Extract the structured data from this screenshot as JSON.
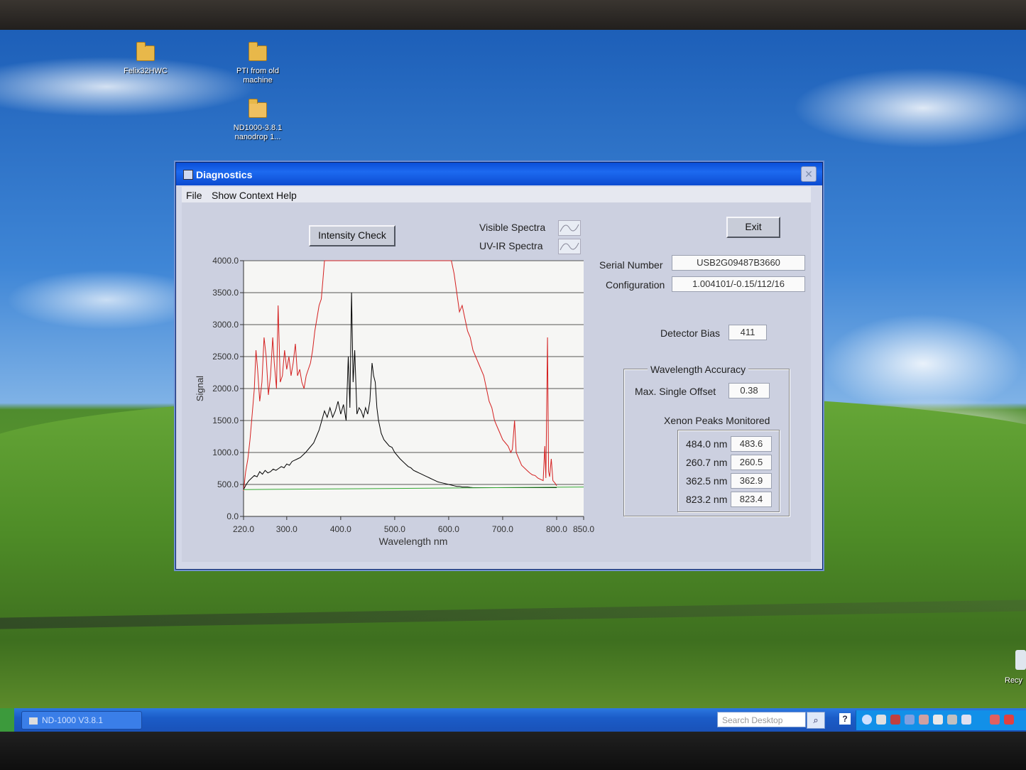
{
  "desktop": {
    "icons": [
      {
        "label": "Felix32HWC"
      },
      {
        "label": "PTI from old machine"
      },
      {
        "label": "ND1000-3.8.1 nanodrop 1..."
      }
    ],
    "recycle_label": "Recy"
  },
  "window": {
    "title": "Diagnostics",
    "menu": [
      "File",
      "Show Context Help"
    ],
    "intensity_button": "Intensity Check",
    "exit_button": "Exit",
    "legend": [
      {
        "label": "Visible Spectra",
        "color": "#d42020"
      },
      {
        "label": "UV-IR Spectra",
        "color": "#000000"
      }
    ],
    "serial_label": "Serial Number",
    "serial_value": "USB2G09487B3660",
    "config_label": "Configuration",
    "config_value": "1.004101/-0.15/112/16",
    "bias_label": "Detector Bias",
    "bias_value": "411",
    "accuracy": {
      "title": "Wavelength Accuracy",
      "offset_label": "Max. Single Offset",
      "offset_value": "0.38",
      "peaks_title": "Xenon Peaks Monitored",
      "peaks": [
        {
          "label": "484.0 nm",
          "value": "483.6"
        },
        {
          "label": "260.7 nm",
          "value": "260.5"
        },
        {
          "label": "362.5 nm",
          "value": "362.9"
        },
        {
          "label": "823.2 nm",
          "value": "823.4"
        }
      ]
    }
  },
  "chart_data": {
    "type": "line",
    "xlabel": "Wavelength nm",
    "ylabel": "Signal",
    "xlim": [
      220,
      850
    ],
    "ylim": [
      0,
      4000
    ],
    "x_ticks": [
      "220.0",
      "300.0",
      "400.0",
      "500.0",
      "600.0",
      "700.0",
      "800.0",
      "850.0"
    ],
    "x_tick_values": [
      220,
      300,
      400,
      500,
      600,
      700,
      800,
      850
    ],
    "y_ticks": [
      "0.0",
      "500.0",
      "1000.0",
      "1500.0",
      "2000.0",
      "2500.0",
      "3000.0",
      "3500.0",
      "4000.0"
    ],
    "y_tick_values": [
      0,
      500,
      1000,
      1500,
      2000,
      2500,
      3000,
      3500,
      4000
    ],
    "grid": true,
    "series": [
      {
        "name": "Visible Spectra",
        "color": "#d42020",
        "points": [
          [
            220,
            400
          ],
          [
            224,
            700
          ],
          [
            228,
            900
          ],
          [
            232,
            1200
          ],
          [
            236,
            1600
          ],
          [
            240,
            2000
          ],
          [
            243,
            2600
          ],
          [
            246,
            2300
          ],
          [
            250,
            1800
          ],
          [
            254,
            2100
          ],
          [
            258,
            2800
          ],
          [
            262,
            2500
          ],
          [
            266,
            1900
          ],
          [
            270,
            2200
          ],
          [
            274,
            2800
          ],
          [
            277,
            2400
          ],
          [
            281,
            2000
          ],
          [
            284,
            3300
          ],
          [
            288,
            2100
          ],
          [
            292,
            2200
          ],
          [
            296,
            2600
          ],
          [
            300,
            2300
          ],
          [
            304,
            2500
          ],
          [
            308,
            2200
          ],
          [
            312,
            2400
          ],
          [
            316,
            2700
          ],
          [
            320,
            2200
          ],
          [
            324,
            2300
          ],
          [
            328,
            2100
          ],
          [
            332,
            2000
          ],
          [
            336,
            2200
          ],
          [
            340,
            2300
          ],
          [
            344,
            2400
          ],
          [
            348,
            2600
          ],
          [
            352,
            2900
          ],
          [
            356,
            3100
          ],
          [
            360,
            3300
          ],
          [
            364,
            3400
          ],
          [
            367,
            3700
          ],
          [
            370,
            4000
          ],
          [
            374,
            4000
          ],
          [
            380,
            4000
          ],
          [
            390,
            4000
          ],
          [
            600,
            4000
          ],
          [
            605,
            4000
          ],
          [
            610,
            3800
          ],
          [
            615,
            3500
          ],
          [
            620,
            3200
          ],
          [
            625,
            3300
          ],
          [
            630,
            3100
          ],
          [
            635,
            2900
          ],
          [
            640,
            2800
          ],
          [
            645,
            2600
          ],
          [
            650,
            2500
          ],
          [
            655,
            2400
          ],
          [
            660,
            2300
          ],
          [
            665,
            2200
          ],
          [
            670,
            2000
          ],
          [
            675,
            1800
          ],
          [
            680,
            1700
          ],
          [
            685,
            1500
          ],
          [
            690,
            1400
          ],
          [
            695,
            1300
          ],
          [
            700,
            1200
          ],
          [
            705,
            1150
          ],
          [
            710,
            1100
          ],
          [
            715,
            1000
          ],
          [
            718,
            1050
          ],
          [
            722,
            1500
          ],
          [
            725,
            1000
          ],
          [
            730,
            900
          ],
          [
            735,
            800
          ],
          [
            740,
            760
          ],
          [
            745,
            720
          ],
          [
            750,
            680
          ],
          [
            755,
            650
          ],
          [
            760,
            640
          ],
          [
            765,
            600
          ],
          [
            770,
            580
          ],
          [
            775,
            560
          ],
          [
            778,
            1100
          ],
          [
            780,
            600
          ],
          [
            783,
            2800
          ],
          [
            785,
            700
          ],
          [
            787,
            620
          ],
          [
            790,
            900
          ],
          [
            793,
            560
          ],
          [
            797,
            520
          ],
          [
            800,
            480
          ]
        ]
      },
      {
        "name": "UV-IR Spectra",
        "color": "#000000",
        "points": [
          [
            220,
            420
          ],
          [
            225,
            500
          ],
          [
            230,
            560
          ],
          [
            235,
            600
          ],
          [
            240,
            640
          ],
          [
            245,
            620
          ],
          [
            250,
            700
          ],
          [
            255,
            660
          ],
          [
            260,
            720
          ],
          [
            265,
            680
          ],
          [
            270,
            700
          ],
          [
            275,
            740
          ],
          [
            280,
            720
          ],
          [
            285,
            750
          ],
          [
            290,
            780
          ],
          [
            295,
            760
          ],
          [
            300,
            820
          ],
          [
            305,
            800
          ],
          [
            310,
            860
          ],
          [
            315,
            880
          ],
          [
            320,
            900
          ],
          [
            325,
            920
          ],
          [
            330,
            960
          ],
          [
            335,
            1000
          ],
          [
            340,
            1050
          ],
          [
            345,
            1100
          ],
          [
            350,
            1150
          ],
          [
            355,
            1250
          ],
          [
            360,
            1350
          ],
          [
            365,
            1500
          ],
          [
            370,
            1650
          ],
          [
            375,
            1550
          ],
          [
            380,
            1700
          ],
          [
            385,
            1550
          ],
          [
            390,
            1650
          ],
          [
            395,
            1800
          ],
          [
            400,
            1600
          ],
          [
            405,
            1750
          ],
          [
            410,
            1500
          ],
          [
            414,
            2500
          ],
          [
            417,
            1700
          ],
          [
            420,
            3500
          ],
          [
            423,
            2100
          ],
          [
            426,
            2600
          ],
          [
            430,
            1600
          ],
          [
            434,
            1700
          ],
          [
            438,
            1650
          ],
          [
            442,
            1550
          ],
          [
            446,
            1700
          ],
          [
            450,
            1600
          ],
          [
            454,
            1800
          ],
          [
            458,
            2400
          ],
          [
            461,
            2200
          ],
          [
            464,
            2100
          ],
          [
            467,
            1700
          ],
          [
            470,
            1500
          ],
          [
            475,
            1300
          ],
          [
            480,
            1200
          ],
          [
            485,
            1150
          ],
          [
            490,
            1100
          ],
          [
            495,
            1080
          ],
          [
            500,
            1000
          ],
          [
            505,
            950
          ],
          [
            510,
            900
          ],
          [
            515,
            860
          ],
          [
            520,
            820
          ],
          [
            525,
            780
          ],
          [
            530,
            760
          ],
          [
            535,
            720
          ],
          [
            540,
            700
          ],
          [
            545,
            680
          ],
          [
            550,
            660
          ],
          [
            555,
            640
          ],
          [
            560,
            620
          ],
          [
            565,
            600
          ],
          [
            570,
            580
          ],
          [
            575,
            560
          ],
          [
            580,
            540
          ],
          [
            585,
            530
          ],
          [
            590,
            520
          ],
          [
            595,
            510
          ],
          [
            600,
            500
          ],
          [
            605,
            490
          ],
          [
            610,
            480
          ],
          [
            615,
            470
          ],
          [
            620,
            470
          ],
          [
            625,
            460
          ],
          [
            630,
            460
          ],
          [
            635,
            460
          ],
          [
            640,
            455
          ],
          [
            645,
            450
          ],
          [
            650,
            450
          ],
          [
            655,
            450
          ],
          [
            660,
            450
          ],
          [
            665,
            450
          ],
          [
            670,
            450
          ],
          [
            675,
            450
          ],
          [
            680,
            450
          ],
          [
            690,
            450
          ],
          [
            700,
            450
          ],
          [
            720,
            450
          ],
          [
            740,
            450
          ],
          [
            760,
            450
          ],
          [
            780,
            450
          ],
          [
            800,
            450
          ]
        ]
      },
      {
        "name": "",
        "color": "#33aa33",
        "points": [
          [
            220,
            420
          ],
          [
            850,
            460
          ]
        ]
      }
    ]
  }
}
